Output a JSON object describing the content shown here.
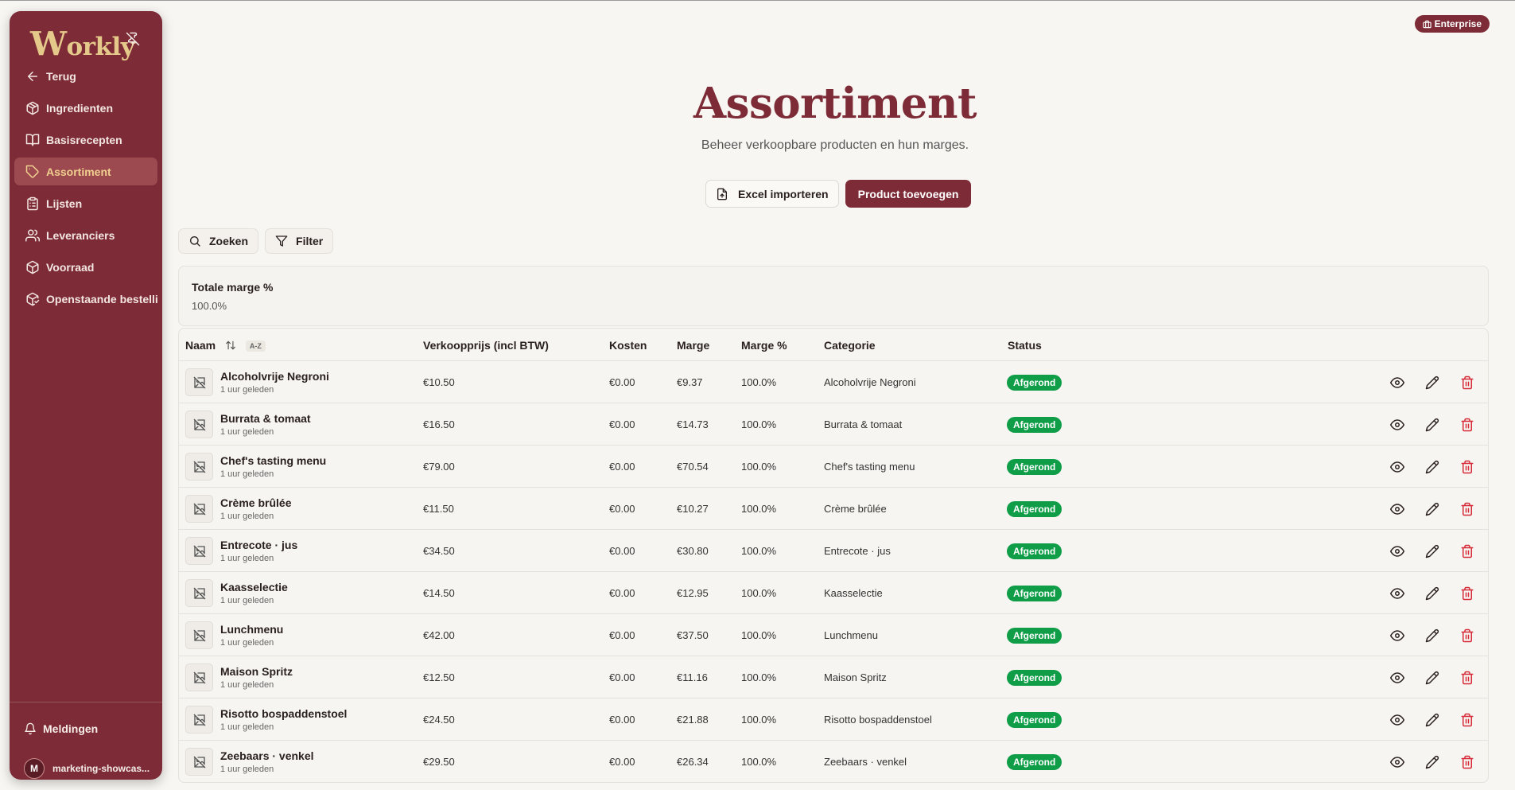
{
  "app": {
    "logo": "Workly",
    "pin_icon": "pin-off-icon"
  },
  "nav": [
    {
      "label": "Terug",
      "icon": "arrow-left-icon",
      "active": false
    },
    {
      "label": "Ingredienten",
      "icon": "package-icon",
      "active": false
    },
    {
      "label": "Basisrecepten",
      "icon": "book-open-icon",
      "active": false
    },
    {
      "label": "Assortiment",
      "icon": "tag-icon",
      "active": true
    },
    {
      "label": "Lijsten",
      "icon": "clipboard-list-icon",
      "active": false
    },
    {
      "label": "Leveranciers",
      "icon": "users-icon",
      "active": false
    },
    {
      "label": "Voorraad",
      "icon": "box-icon",
      "active": false
    },
    {
      "label": "Openstaande bestellingen",
      "icon": "package-check-icon",
      "active": false
    }
  ],
  "footer": {
    "notifications": "Meldingen",
    "avatar_letter": "M",
    "user": "marketing-showcas..."
  },
  "plan_badge": "Enterprise",
  "header": {
    "title": "Assortiment",
    "subtitle": "Beheer verkoopbare producten en hun marges."
  },
  "actions": {
    "import": "Excel importeren",
    "add": "Product toevoegen"
  },
  "toolbar": {
    "search": "Zoeken",
    "filter": "Filter"
  },
  "summary": {
    "label": "Totale marge %",
    "value": "100.0%"
  },
  "table": {
    "columns": {
      "name": "Naam",
      "sort_chip": "A-Z",
      "price": "Verkoopprijs (incl BTW)",
      "cost": "Kosten",
      "margin": "Marge",
      "margin_pct": "Marge %",
      "category": "Categorie",
      "status": "Status"
    },
    "rows": [
      {
        "name": "Alcoholvrije Negroni",
        "time": "1 uur geleden",
        "price": "€10.50",
        "cost": "€0.00",
        "margin": "€9.37",
        "margin_pct": "100.0%",
        "category": "Alcoholvrije Negroni",
        "status": "Afgerond"
      },
      {
        "name": "Burrata & tomaat",
        "time": "1 uur geleden",
        "price": "€16.50",
        "cost": "€0.00",
        "margin": "€14.73",
        "margin_pct": "100.0%",
        "category": "Burrata & tomaat",
        "status": "Afgerond"
      },
      {
        "name": "Chef's tasting menu",
        "time": "1 uur geleden",
        "price": "€79.00",
        "cost": "€0.00",
        "margin": "€70.54",
        "margin_pct": "100.0%",
        "category": "Chef's tasting menu",
        "status": "Afgerond"
      },
      {
        "name": "Crème brûlée",
        "time": "1 uur geleden",
        "price": "€11.50",
        "cost": "€0.00",
        "margin": "€10.27",
        "margin_pct": "100.0%",
        "category": "Crème brûlée",
        "status": "Afgerond"
      },
      {
        "name": "Entrecote · jus",
        "time": "1 uur geleden",
        "price": "€34.50",
        "cost": "€0.00",
        "margin": "€30.80",
        "margin_pct": "100.0%",
        "category": "Entrecote · jus",
        "status": "Afgerond"
      },
      {
        "name": "Kaasselectie",
        "time": "1 uur geleden",
        "price": "€14.50",
        "cost": "€0.00",
        "margin": "€12.95",
        "margin_pct": "100.0%",
        "category": "Kaasselectie",
        "status": "Afgerond"
      },
      {
        "name": "Lunchmenu",
        "time": "1 uur geleden",
        "price": "€42.00",
        "cost": "€0.00",
        "margin": "€37.50",
        "margin_pct": "100.0%",
        "category": "Lunchmenu",
        "status": "Afgerond"
      },
      {
        "name": "Maison Spritz",
        "time": "1 uur geleden",
        "price": "€12.50",
        "cost": "€0.00",
        "margin": "€11.16",
        "margin_pct": "100.0%",
        "category": "Maison Spritz",
        "status": "Afgerond"
      },
      {
        "name": "Risotto bospaddenstoel",
        "time": "1 uur geleden",
        "price": "€24.50",
        "cost": "€0.00",
        "margin": "€21.88",
        "margin_pct": "100.0%",
        "category": "Risotto bospaddenstoel",
        "status": "Afgerond"
      },
      {
        "name": "Zeebaars · venkel",
        "time": "1 uur geleden",
        "price": "€29.50",
        "cost": "€0.00",
        "margin": "€26.34",
        "margin_pct": "100.0%",
        "category": "Zeebaars · venkel",
        "status": "Afgerond"
      }
    ]
  },
  "colors": {
    "brand": "#7d2c37",
    "accent": "#e5c98a",
    "status_done": "#0f9d48",
    "delete": "#d62a38"
  }
}
